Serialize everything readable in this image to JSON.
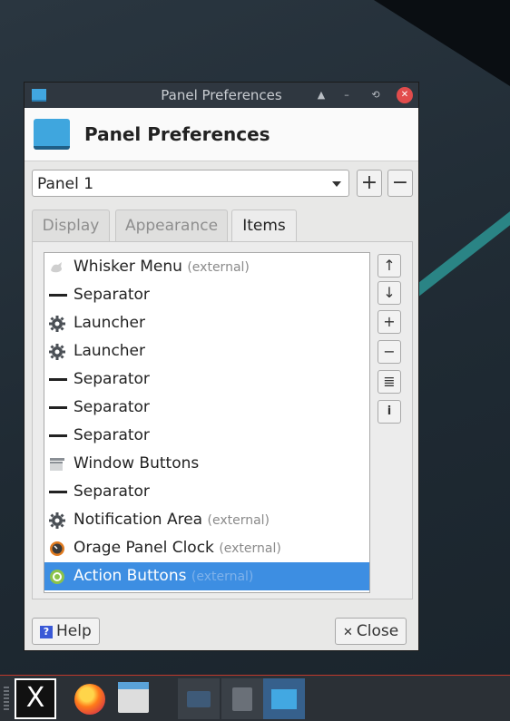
{
  "window": {
    "title": "Panel Preferences",
    "header_title": "Panel Preferences",
    "controls": [
      "▲",
      "–",
      "⟲",
      "✕"
    ]
  },
  "panel_select": {
    "value": "Panel 1",
    "add": "+",
    "remove": "−"
  },
  "tabs": [
    {
      "label": "Display",
      "active": false
    },
    {
      "label": "Appearance",
      "active": false
    },
    {
      "label": "Items",
      "active": true
    }
  ],
  "items": [
    {
      "name": "Whisker Menu",
      "ext": "(external)",
      "icon": "whisker-icon"
    },
    {
      "name": "Separator",
      "ext": "",
      "icon": "separator-icon"
    },
    {
      "name": "Launcher",
      "ext": "",
      "icon": "gear-icon"
    },
    {
      "name": "Launcher",
      "ext": "",
      "icon": "gear-icon"
    },
    {
      "name": "Separator",
      "ext": "",
      "icon": "separator-icon"
    },
    {
      "name": "Separator",
      "ext": "",
      "icon": "separator-icon"
    },
    {
      "name": "Separator",
      "ext": "",
      "icon": "separator-icon"
    },
    {
      "name": "Window Buttons",
      "ext": "",
      "icon": "window-buttons-icon"
    },
    {
      "name": "Separator",
      "ext": "",
      "icon": "separator-icon"
    },
    {
      "name": "Notification Area",
      "ext": "(external)",
      "icon": "gear-icon"
    },
    {
      "name": "Orage Panel Clock",
      "ext": "(external)",
      "icon": "clock-icon"
    },
    {
      "name": "Action Buttons",
      "ext": "(external)",
      "icon": "action-buttons-icon",
      "selected": true
    }
  ],
  "side_buttons": [
    "↑",
    "↓",
    "+",
    "−",
    "≣",
    "i"
  ],
  "buttons": {
    "help": "Help",
    "help_badge": "?",
    "close": "Close",
    "close_glyph": "✕"
  },
  "taskbar": {
    "mx_glyph": "X"
  },
  "colors": {
    "selection": "#3d8ee2",
    "titlebar": "#2f3740",
    "accent": "#41a6e0"
  }
}
